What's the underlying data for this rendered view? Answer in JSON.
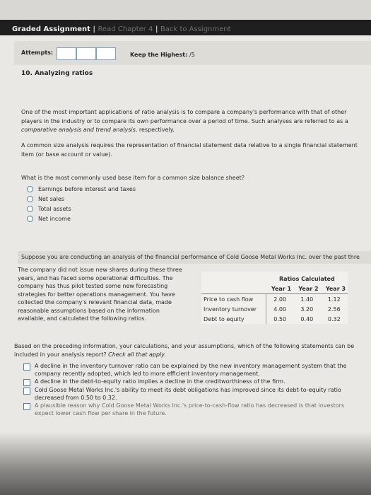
{
  "header": {
    "title": "Graded Assignment",
    "separator": "|",
    "read_chapter_link": "Read Chapter 4",
    "back_link": "Back to Assignment"
  },
  "attempts": {
    "label": "Attempts:",
    "keep_label": "Keep the Highest:",
    "keep_value": "/5"
  },
  "question": {
    "number_title": "10. Analyzing ratios",
    "intro_before_italic": "One of the most important applications of ratio analysis is to compare a company's performance with that of other players in the industry or to compare its own performance over a period of time. Such analyses are referred to as a ",
    "intro_italic": "comparative analysis and trend analysis",
    "intro_after_italic": ", respectively.",
    "common_size_text": "A common size analysis requires the representation of financial statement data relative to a single financial statement item (or base account or value).",
    "q1_text": "What is the most commonly used base item for a common size balance sheet?",
    "q1_options": [
      "Earnings before interest and taxes",
      "Net sales",
      "Total assets",
      "Net income"
    ],
    "suppose_text": "Suppose you are conducting an analysis of the financial performance of Cold Goose Metal Works Inc. over the past thre",
    "company_text": "The company did not issue new shares during these three years, and has faced some operational difficulties. The company has thus pilot tested some new forecasting strategies for better operations management. You have collected the company's relevant financial data, made reasonable assumptions based on the information available, and calculated the following ratios.",
    "table": {
      "caption": "Ratios Calculated",
      "headers": [
        "",
        "Year 1",
        "Year 2",
        "Year 3"
      ],
      "rows": [
        {
          "label": "Price to cash flow",
          "values": [
            "2.00",
            "1.40",
            "1.12"
          ]
        },
        {
          "label": "Inventory turnover",
          "values": [
            "4.00",
            "3.20",
            "2.56"
          ]
        },
        {
          "label": "Debt to equity",
          "values": [
            "0.50",
            "0.40",
            "0.32"
          ]
        }
      ]
    },
    "q2_text_main": "Based on the preceding information, your calculations, and your assumptions, which of the following statements can be included in your analysis report? ",
    "q2_text_italic": "Check all that apply.",
    "q2_options": [
      "A decline in the inventory turnover ratio can be explained by the new inventory management system that the company recently adopted, which led to more efficient inventory management.",
      "A decline in the debt-to-equity ratio implies a decline in the creditworthiness of the firm.",
      "Cold Goose Metal Works Inc.'s ability to meet its debt obligations has improved since its debt-to-equity ratio decreased from 0.50 to 0.32.",
      "A plausible reason why Cold Goose Metal Works Inc.'s price-to-cash-flow ratio has decreased is that investors expect lower cash flow per share in the future."
    ]
  },
  "colors": {
    "accent": "#4a7fb0",
    "topbar": "#1f1f1f",
    "page": "#e9e8e4"
  }
}
